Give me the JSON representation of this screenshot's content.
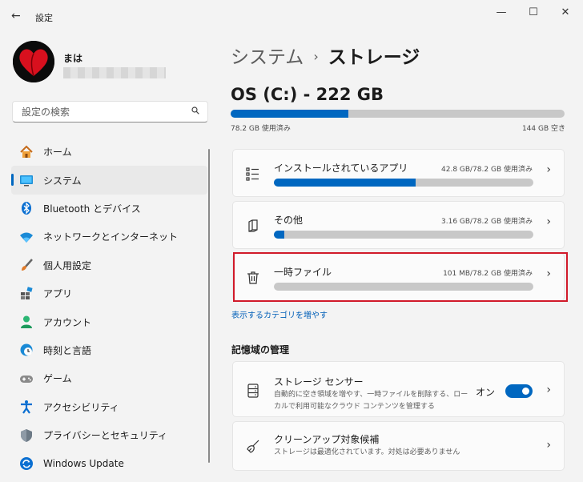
{
  "window": {
    "title": "設定",
    "back_icon": "←",
    "minimize": "—",
    "maximize": "☐",
    "close": "✕"
  },
  "user": {
    "name": "まは"
  },
  "search": {
    "placeholder": "設定の検索"
  },
  "nav": [
    {
      "label": "ホーム",
      "icon": "home-icon"
    },
    {
      "label": "システム",
      "icon": "system-icon",
      "active": true
    },
    {
      "label": "Bluetooth とデバイス",
      "icon": "bluetooth-icon"
    },
    {
      "label": "ネットワークとインターネット",
      "icon": "wifi-icon"
    },
    {
      "label": "個人用設定",
      "icon": "brush-icon"
    },
    {
      "label": "アプリ",
      "icon": "apps-icon"
    },
    {
      "label": "アカウント",
      "icon": "account-icon"
    },
    {
      "label": "時刻と言語",
      "icon": "clock-globe-icon"
    },
    {
      "label": "ゲーム",
      "icon": "gamepad-icon"
    },
    {
      "label": "アクセシビリティ",
      "icon": "accessibility-icon"
    },
    {
      "label": "プライバシーとセキュリティ",
      "icon": "shield-icon"
    },
    {
      "label": "Windows Update",
      "icon": "update-icon"
    }
  ],
  "breadcrumb": {
    "parent": "システム",
    "separator": "›",
    "current": "ストレージ"
  },
  "drive": {
    "title": "OS (C:) - 222 GB",
    "used_label": "78.2 GB 使用済み",
    "free_label": "144 GB 空き",
    "used_fraction": 0.352
  },
  "categories": [
    {
      "label": "インストールされているアプリ",
      "size": "42.8 GB/78.2 GB 使用済み",
      "fraction": 0.547,
      "icon": "apps-list-icon"
    },
    {
      "label": "その他",
      "size": "3.16 GB/78.2 GB 使用済み",
      "fraction": 0.04,
      "icon": "other-files-icon"
    },
    {
      "label": "一時ファイル",
      "size": "101 MB/78.2 GB 使用済み",
      "fraction": 0.0013,
      "icon": "trash-icon"
    }
  ],
  "more_categories_link": "表示するカテゴリを増やす",
  "management": {
    "heading": "記憶域の管理",
    "items": [
      {
        "title": "ストレージ センサー",
        "desc": "自動的に空き領域を増やす、一時ファイルを削除する、ローカルで利用可能なクラウド コンテンツを管理する",
        "toggle_label": "オン",
        "toggle_on": true,
        "icon": "storage-sense-icon"
      },
      {
        "title": "クリーンアップ対象候補",
        "desc": "ストレージは最適化されています。対処は必要ありません",
        "icon": "broom-icon"
      }
    ]
  },
  "colors": {
    "accent": "#0067c0",
    "highlight_border": "#d11a2a"
  }
}
